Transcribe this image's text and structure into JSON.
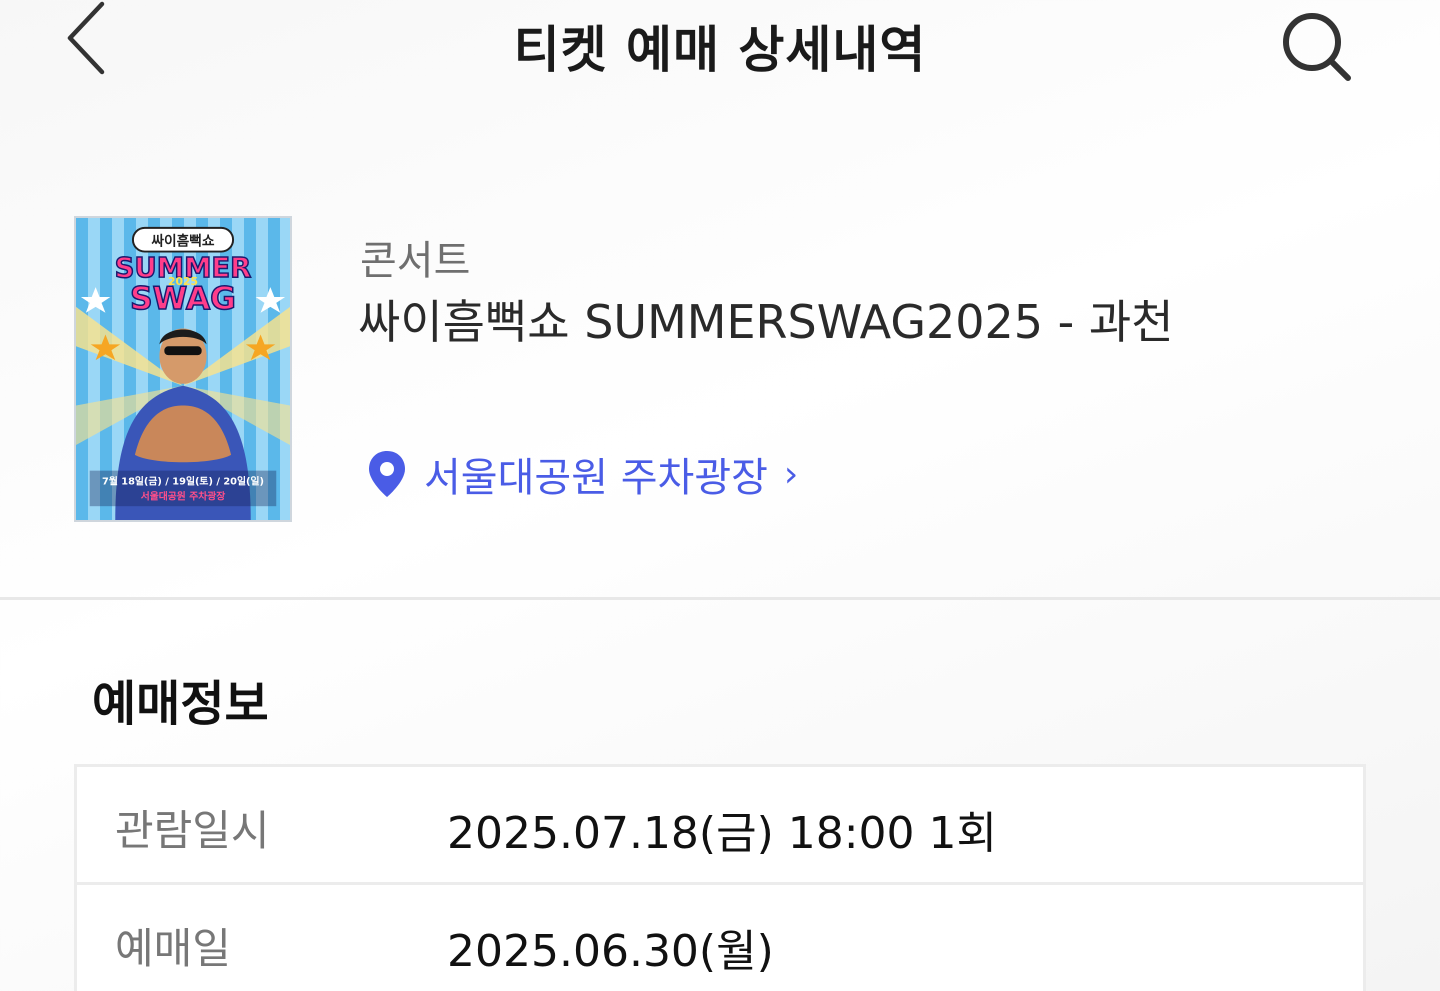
{
  "header": {
    "title": "티켓 예매 상세내역",
    "back_icon": "chevron-left-icon",
    "search_icon": "search-icon"
  },
  "event": {
    "poster": {
      "alt": "SUMMER SWAG 2025 poster",
      "logo_text": "싸이흠뻑쇼",
      "headline_1": "SUMMER",
      "headline_year": "2025",
      "headline_2": "SWAG",
      "dates_text": "7월 18일(금) / 19일(토) / 20일(일)",
      "venue_text": "서울대공원 주차광장"
    },
    "category": "콘서트",
    "title": "싸이흠뻑쇼 SUMMERSWAG2025 - 과천",
    "venue": "서울대공원 주차광장",
    "venue_chevron": "›",
    "venue_icon": "map-pin-icon"
  },
  "booking": {
    "section_title": "예매정보",
    "rows": [
      {
        "label": "관람일시",
        "value": "2025.07.18(금) 18:00 1회"
      },
      {
        "label": "예매일",
        "value": "2025.06.30(월)"
      }
    ]
  },
  "colors": {
    "accent": "#4a5ce6",
    "divider": "#ececec",
    "label": "#777777"
  }
}
